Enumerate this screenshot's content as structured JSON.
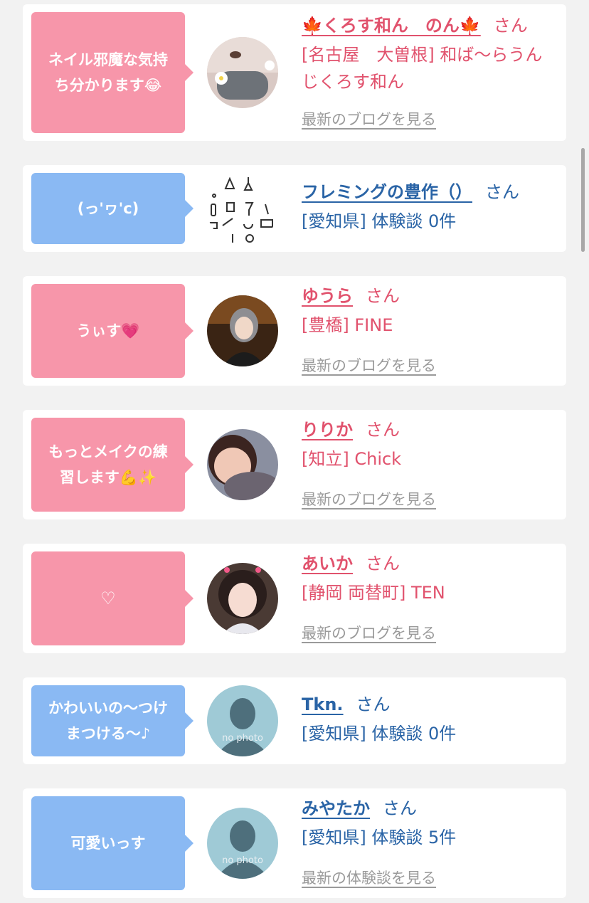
{
  "colors": {
    "pink_bubble": "#f796aa",
    "blue_bubble": "#8ab9f3",
    "pink_text": "#e1526d",
    "blue_text": "#2a64a6",
    "link_gray": "#9a9a9a",
    "page_bg": "#f2f2f2"
  },
  "cards": [
    {
      "bubble_line1": "ネイル邪魔な気持",
      "bubble_line2": "ち分かります😂",
      "name": "🍁くろす和ん　のん🍁",
      "suffix": "さん",
      "detail": "[名古屋　大曽根] 和ば〜らうんじくろす和ん",
      "link": "最新のブログを見る",
      "avatar_icon": "masked-face-avatar"
    },
    {
      "bubble_line1": "(っ'ヮ'c)",
      "bubble_line2": "",
      "name": "フレミングの豊作（）",
      "suffix": "さん",
      "detail": "[愛知県] 体験談 0件",
      "link": "",
      "avatar_icon": "lab-equipment-avatar"
    },
    {
      "bubble_line1": "うぃす💗",
      "bubble_line2": "",
      "name": "ゆうら",
      "suffix": "さん",
      "detail": "[豊橋] FINE",
      "link": "最新のブログを見る",
      "avatar_icon": "woman-photo-avatar"
    },
    {
      "bubble_line1": "もっとメイクの練",
      "bubble_line2": "習します💪✨",
      "name": "りりか",
      "suffix": "さん",
      "detail": "[知立] Chick",
      "link": "最新のブログを見る",
      "avatar_icon": "woman-photo-avatar"
    },
    {
      "bubble_line1": "♡",
      "bubble_line2": "",
      "name": "あいか",
      "suffix": "さん",
      "detail": "[静岡 両替町] TEN",
      "link": "最新のブログを見る",
      "avatar_icon": "woman-photo-avatar"
    },
    {
      "bubble_line1": "かわいいの〜つけ",
      "bubble_line2": "まつける〜♪",
      "name": "Tkn.",
      "suffix": "さん",
      "detail": "[愛知県] 体験談 0件",
      "link": "",
      "avatar_icon": "no-photo-avatar",
      "avatar_text": "no photo"
    },
    {
      "bubble_line1": "可愛いっす",
      "bubble_line2": "",
      "name": "みやたか",
      "suffix": "さん",
      "detail": "[愛知県] 体験談 5件",
      "link": "最新の体験談を見る",
      "avatar_icon": "no-photo-avatar",
      "avatar_text": "no photo"
    }
  ]
}
